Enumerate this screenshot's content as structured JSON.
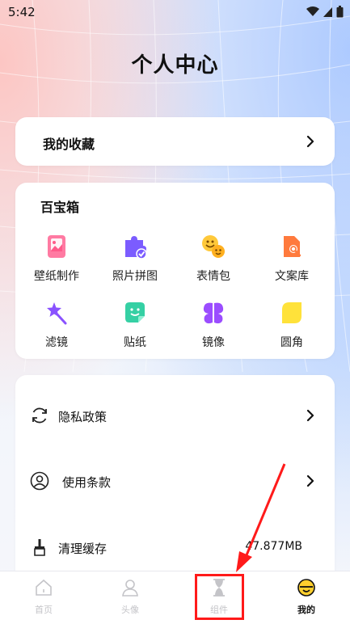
{
  "status_bar": {
    "time": "5:42"
  },
  "page": {
    "title": "个人中心"
  },
  "favorites": {
    "label": "我的收藏"
  },
  "toolbox": {
    "title": "百宝箱",
    "items": [
      {
        "label": "壁纸制作",
        "icon": "wallpaper-icon"
      },
      {
        "label": "照片拼图",
        "icon": "puzzle-icon"
      },
      {
        "label": "表情包",
        "icon": "emoji-pack-icon"
      },
      {
        "label": "文案库",
        "icon": "document-search-icon"
      },
      {
        "label": "滤镜",
        "icon": "magic-wand-icon"
      },
      {
        "label": "贴纸",
        "icon": "sticker-icon"
      },
      {
        "label": "镜像",
        "icon": "mirror-icon"
      },
      {
        "label": "圆角",
        "icon": "rounded-corner-icon"
      }
    ]
  },
  "settings": {
    "privacy": "隐私政策",
    "terms": "使用条款",
    "clear_cache": "清理缓存",
    "cache_size": "47.877MB"
  },
  "tabbar": {
    "home": "首页",
    "avatar": "头像",
    "widgets": "组件",
    "mine": "我的"
  },
  "colors": {
    "highlight": "#ff1a1a",
    "wallpaper": "#ff5a8a",
    "puzzle": "#7b5cff",
    "emoji": "#ffc93a",
    "doc": "#ff7a3d",
    "wand": "#8a52ff",
    "sticker": "#35d0a4",
    "mirror": "#9b4dff",
    "rounded": "#ffe23a"
  }
}
